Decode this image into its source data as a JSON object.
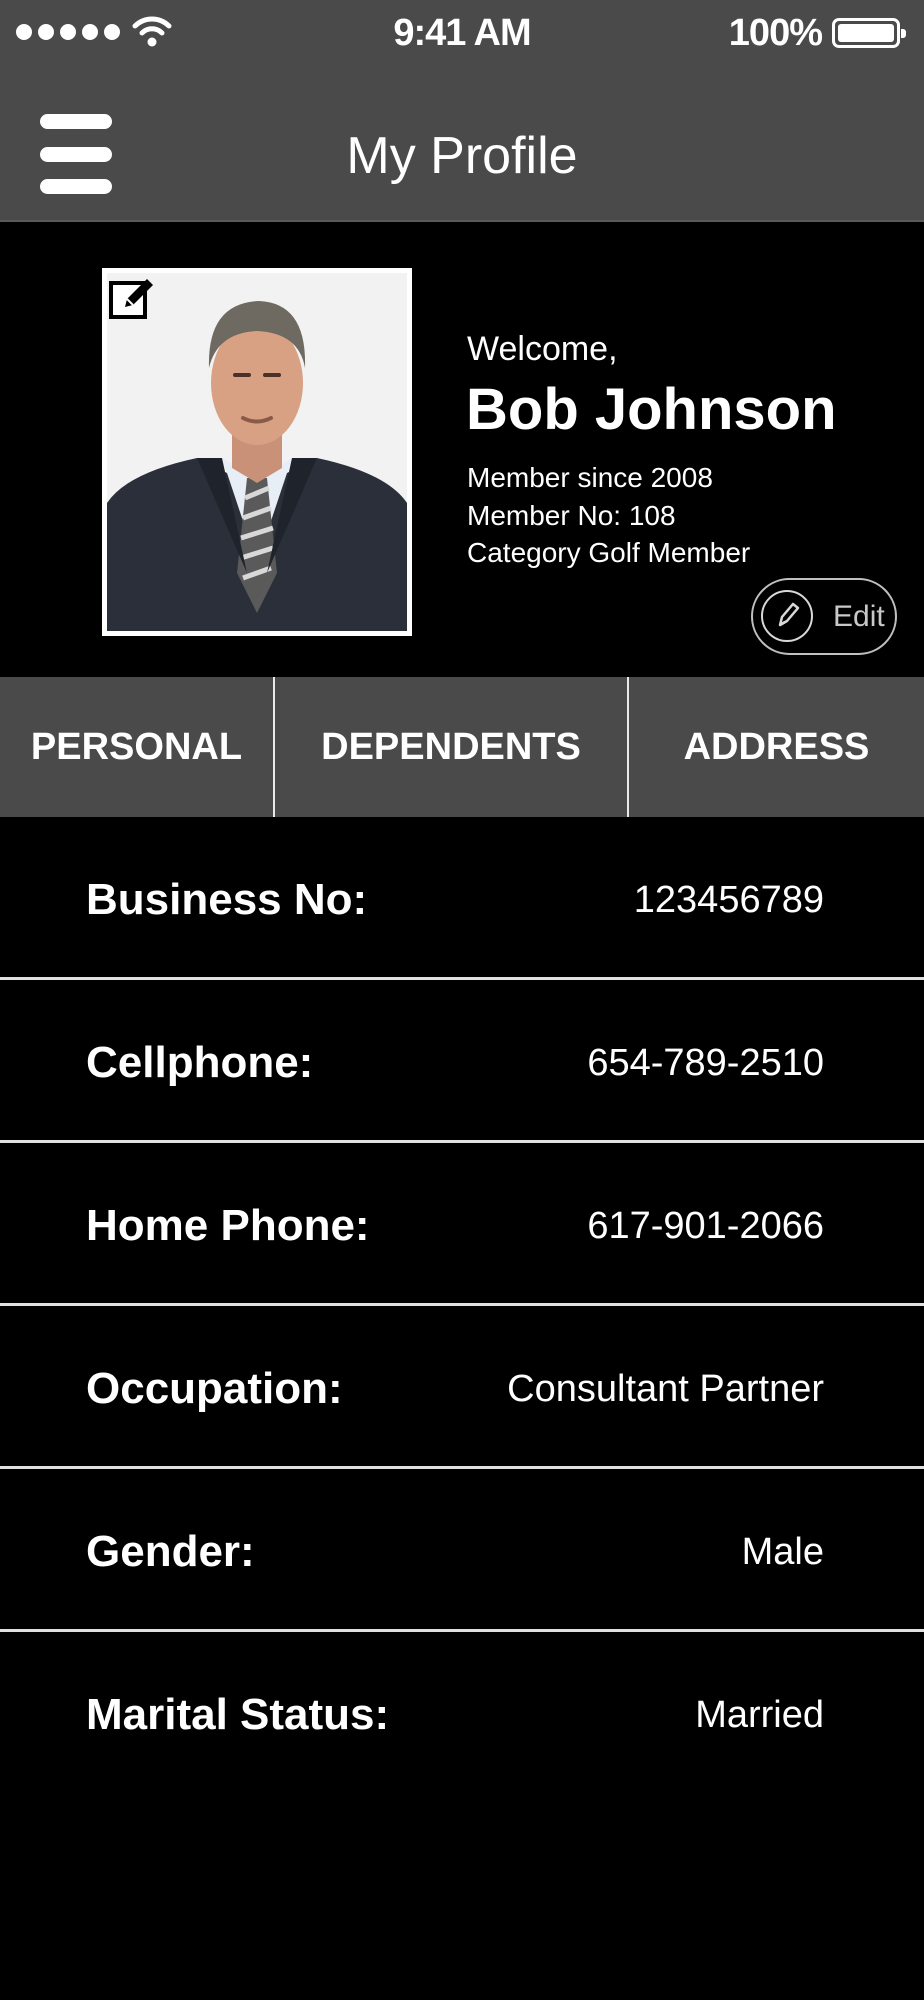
{
  "status_bar": {
    "time": "9:41 AM",
    "battery_percent": "100%",
    "signal_icon": "signal-dots-icon",
    "wifi_icon": "wifi-icon",
    "battery_icon": "battery-icon"
  },
  "navbar": {
    "title": "My Profile",
    "menu_icon": "hamburger-menu-icon"
  },
  "profile": {
    "welcome": "Welcome,",
    "name": "Bob Johnson",
    "member_since": "Member since 2008",
    "member_no": "Member No: 108",
    "category": "Category Golf Member",
    "edit_label": "Edit",
    "photo_edit_icon": "edit-square-icon",
    "edit_button_icon": "pencil-icon"
  },
  "tabs": [
    {
      "label": "PERSONAL"
    },
    {
      "label": "DEPENDENTS"
    },
    {
      "label": "ADDRESS"
    }
  ],
  "fields": [
    {
      "label": "Business No:",
      "value": "123456789"
    },
    {
      "label": "Cellphone:",
      "value": "654-789-2510"
    },
    {
      "label": "Home Phone:",
      "value": "617-901-2066"
    },
    {
      "label": "Occupation:",
      "value": "Consultant Partner"
    },
    {
      "label": "Gender:",
      "value": "Male"
    },
    {
      "label": "Marital Status:",
      "value": "Married"
    }
  ],
  "colors": {
    "bar_background": "#4a4a4a",
    "page_background": "#000000",
    "text": "#ffffff"
  }
}
